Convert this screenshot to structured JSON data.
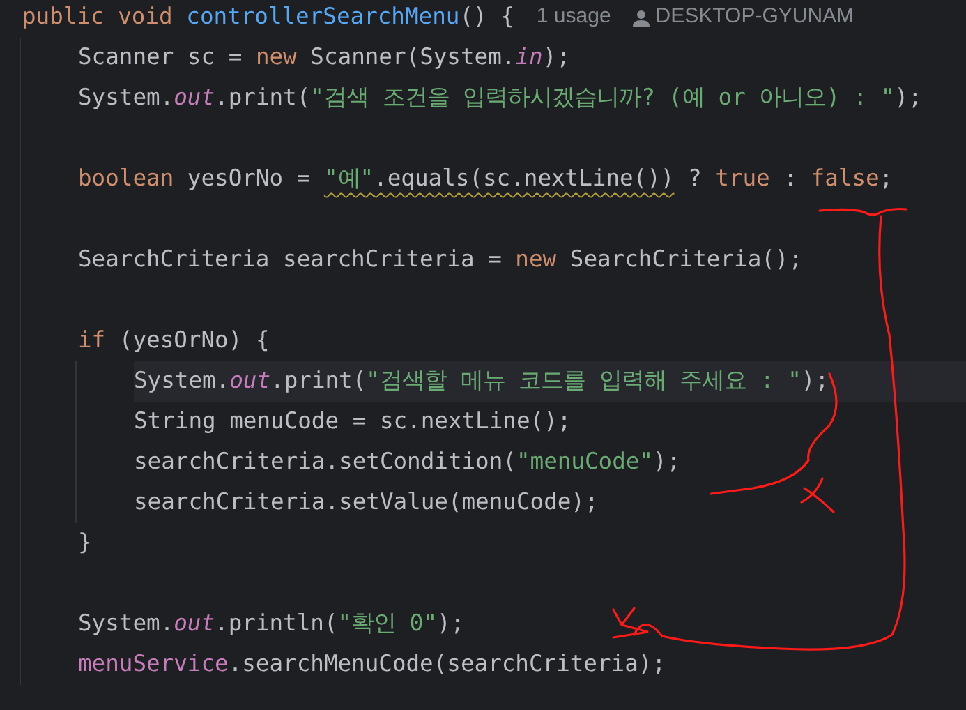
{
  "editor": {
    "lines": [
      {
        "kind": "code",
        "current": false,
        "tokens": [
          {
            "text": "public void ",
            "kind": "keyword"
          },
          {
            "text": "controllerSearchMenu",
            "kind": "declaration"
          },
          {
            "text": "() {",
            "kind": "plain"
          }
        ],
        "hints": {
          "usages": "1 usage",
          "author": "DESKTOP-GYUNAM"
        },
        "children": [
          {
            "kind": "code",
            "current": false,
            "tokens": [
              {
                "text": "Scanner sc = ",
                "kind": "plain"
              },
              {
                "text": "new ",
                "kind": "keyword"
              },
              {
                "text": "Scanner(System.",
                "kind": "plain"
              },
              {
                "text": "in",
                "kind": "static"
              },
              {
                "text": ");",
                "kind": "plain"
              }
            ]
          },
          {
            "kind": "code",
            "current": false,
            "tokens": [
              {
                "text": "System.",
                "kind": "plain"
              },
              {
                "text": "out",
                "kind": "static"
              },
              {
                "text": ".print(",
                "kind": "plain"
              },
              {
                "text": "\"검색 조건을 입력하시겠습니까? (예 or 아니오) : \"",
                "kind": "string"
              },
              {
                "text": ");",
                "kind": "plain"
              }
            ]
          },
          {
            "kind": "blank",
            "current": false
          },
          {
            "kind": "code",
            "current": false,
            "tokens": [
              {
                "text": "boolean ",
                "kind": "keyword"
              },
              {
                "text": "yesOrNo = ",
                "kind": "plain"
              },
              {
                "text": "\"예\"",
                "kind": "string",
                "warning": true
              },
              {
                "text": ".equals(sc.nextLine())",
                "kind": "plain",
                "warning": true
              },
              {
                "text": " ? ",
                "kind": "plain"
              },
              {
                "text": "true",
                "kind": "keyword"
              },
              {
                "text": " : ",
                "kind": "plain"
              },
              {
                "text": "false",
                "kind": "keyword"
              },
              {
                "text": ";",
                "kind": "plain"
              }
            ]
          },
          {
            "kind": "blank",
            "current": false
          },
          {
            "kind": "code",
            "current": false,
            "tokens": [
              {
                "text": "SearchCriteria searchCriteria = ",
                "kind": "plain"
              },
              {
                "text": "new ",
                "kind": "keyword"
              },
              {
                "text": "SearchCriteria();",
                "kind": "plain"
              }
            ]
          },
          {
            "kind": "blank",
            "current": false
          },
          {
            "kind": "code",
            "current": false,
            "tokens": [
              {
                "text": "if ",
                "kind": "keyword"
              },
              {
                "text": "(yesOrNo) {",
                "kind": "plain"
              }
            ],
            "children": [
              {
                "kind": "code",
                "current": true,
                "tokens": [
                  {
                    "text": "System.",
                    "kind": "plain"
                  },
                  {
                    "text": "out",
                    "kind": "static"
                  },
                  {
                    "text": ".print(",
                    "kind": "plain"
                  },
                  {
                    "text": "\"검색할 메뉴 코드를 입력해 주세요 : \"",
                    "kind": "string"
                  },
                  {
                    "text": ");",
                    "kind": "plain"
                  }
                ]
              },
              {
                "kind": "code",
                "current": false,
                "tokens": [
                  {
                    "text": "String menuCode = sc.nextLine();",
                    "kind": "plain"
                  }
                ]
              },
              {
                "kind": "code",
                "current": false,
                "tokens": [
                  {
                    "text": "searchCriteria.setCondition(",
                    "kind": "plain"
                  },
                  {
                    "text": "\"menuCode\"",
                    "kind": "string"
                  },
                  {
                    "text": ");",
                    "kind": "plain"
                  }
                ]
              },
              {
                "kind": "code",
                "current": false,
                "tokens": [
                  {
                    "text": "searchCriteria.setValue(menuCode);",
                    "kind": "plain"
                  }
                ]
              }
            ]
          },
          {
            "kind": "code",
            "current": false,
            "tokens": [
              {
                "text": "}",
                "kind": "plain"
              }
            ]
          },
          {
            "kind": "blank",
            "current": false
          },
          {
            "kind": "code",
            "current": false,
            "tokens": [
              {
                "text": "System.",
                "kind": "plain"
              },
              {
                "text": "out",
                "kind": "static"
              },
              {
                "text": ".println(",
                "kind": "plain"
              },
              {
                "text": "\"확인 0\"",
                "kind": "string"
              },
              {
                "text": ");",
                "kind": "plain"
              }
            ]
          },
          {
            "kind": "code",
            "current": false,
            "tokens": [
              {
                "text": "menuService",
                "kind": "member"
              },
              {
                "text": ".searchMenuCode(searchCriteria);",
                "kind": "plain"
              }
            ]
          }
        ]
      }
    ]
  }
}
